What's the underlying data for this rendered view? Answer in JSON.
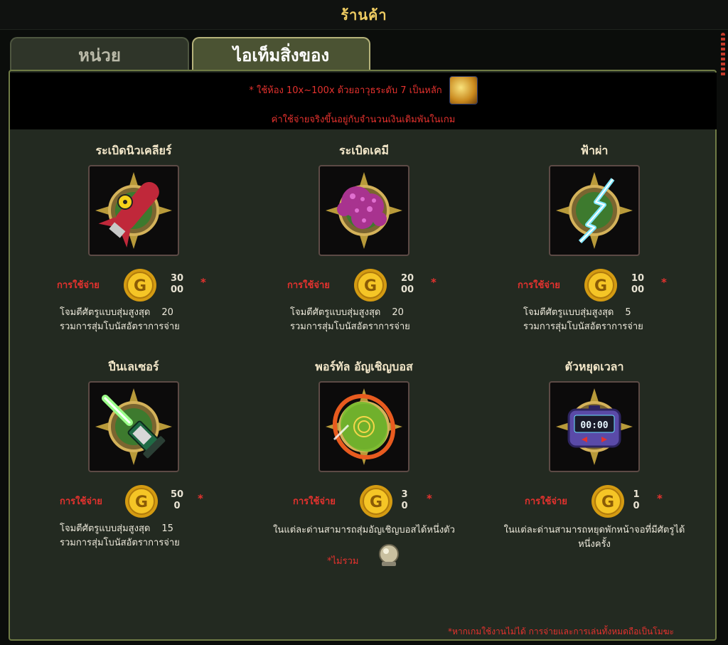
{
  "window": {
    "title": "ร้านค้า"
  },
  "tabs": [
    {
      "label": "หน่วย",
      "active": false
    },
    {
      "label": "ไอเท็มสิ่งของ",
      "active": true
    }
  ],
  "notice": {
    "line1": "* ใช้ห้อง 10x~100x ด้วยอาวุธระดับ 7 เป็นหลัก",
    "line2": "ค่าใช้จ่ายจริงขึ้นอยู่กับจำนวนเงินเดิมพันในเกม"
  },
  "items": [
    {
      "name": "ระเบิดนิวเคลียร์",
      "icon": "nuke-missile-icon",
      "cost_label": "การใช้จ่าย",
      "price": "3000",
      "star": "*",
      "desc1": "โจมตีศัตรูแบบสุ่มสูงสุด",
      "desc_num": "20",
      "desc2": "รวมการสุ่มโบนัสอัตราการจ่าย"
    },
    {
      "name": "ระเบิดเคมี",
      "icon": "chemical-bomb-icon",
      "cost_label": "การใช้จ่าย",
      "price": "2000",
      "star": "*",
      "desc1": "โจมตีศัตรูแบบสุ่มสูงสุด",
      "desc_num": "20",
      "desc2": "รวมการสุ่มโบนัสอัตราการจ่าย"
    },
    {
      "name": "ฟ้าผ่า",
      "icon": "lightning-icon",
      "cost_label": "การใช้จ่าย",
      "price": "1000",
      "star": "*",
      "desc1": "โจมตีศัตรูแบบสุ่มสูงสุด",
      "desc_num": "5",
      "desc2": "รวมการสุ่มโบนัสอัตราการจ่าย"
    },
    {
      "name": "ปืนเลเซอร์",
      "icon": "laser-gun-icon",
      "cost_label": "การใช้จ่าย",
      "price": "500",
      "star": "*",
      "desc1": "โจมตีศัตรูแบบสุ่มสูงสุด",
      "desc_num": "15",
      "desc2": "รวมการสุ่มโบนัสอัตราการจ่าย"
    },
    {
      "name": "พอร์ทัล อัญเชิญบอส",
      "icon": "portal-icon",
      "cost_label": "การใช้จ่าย",
      "price": "30",
      "star": "*",
      "desc1": "ในแต่ละด่านสามารถสุ่มอัญเชิญบอสได้หนึ่งตัว",
      "desc2": "",
      "excluded": "*ไม่รวม"
    },
    {
      "name": "ตัวหยุดเวลา",
      "icon": "time-stopper-icon",
      "cost_label": "การใช้จ่าย",
      "price": "10",
      "star": "*",
      "desc1": "ในแต่ละด่านสามารถหยุดพักหน้าจอที่มีศัตรูได้",
      "desc2": "หนึ่งครั้ง",
      "timer_display": "00:00"
    }
  ],
  "footnote": "*หากเกมใช้งานไม่ได้ การจ่ายและการเล่นทั้งหมดถือเป็นโมฆะ",
  "colors": {
    "accent_gold": "#f0cd63",
    "warning_red": "#e5322e",
    "panel_bg": "#232a21"
  }
}
